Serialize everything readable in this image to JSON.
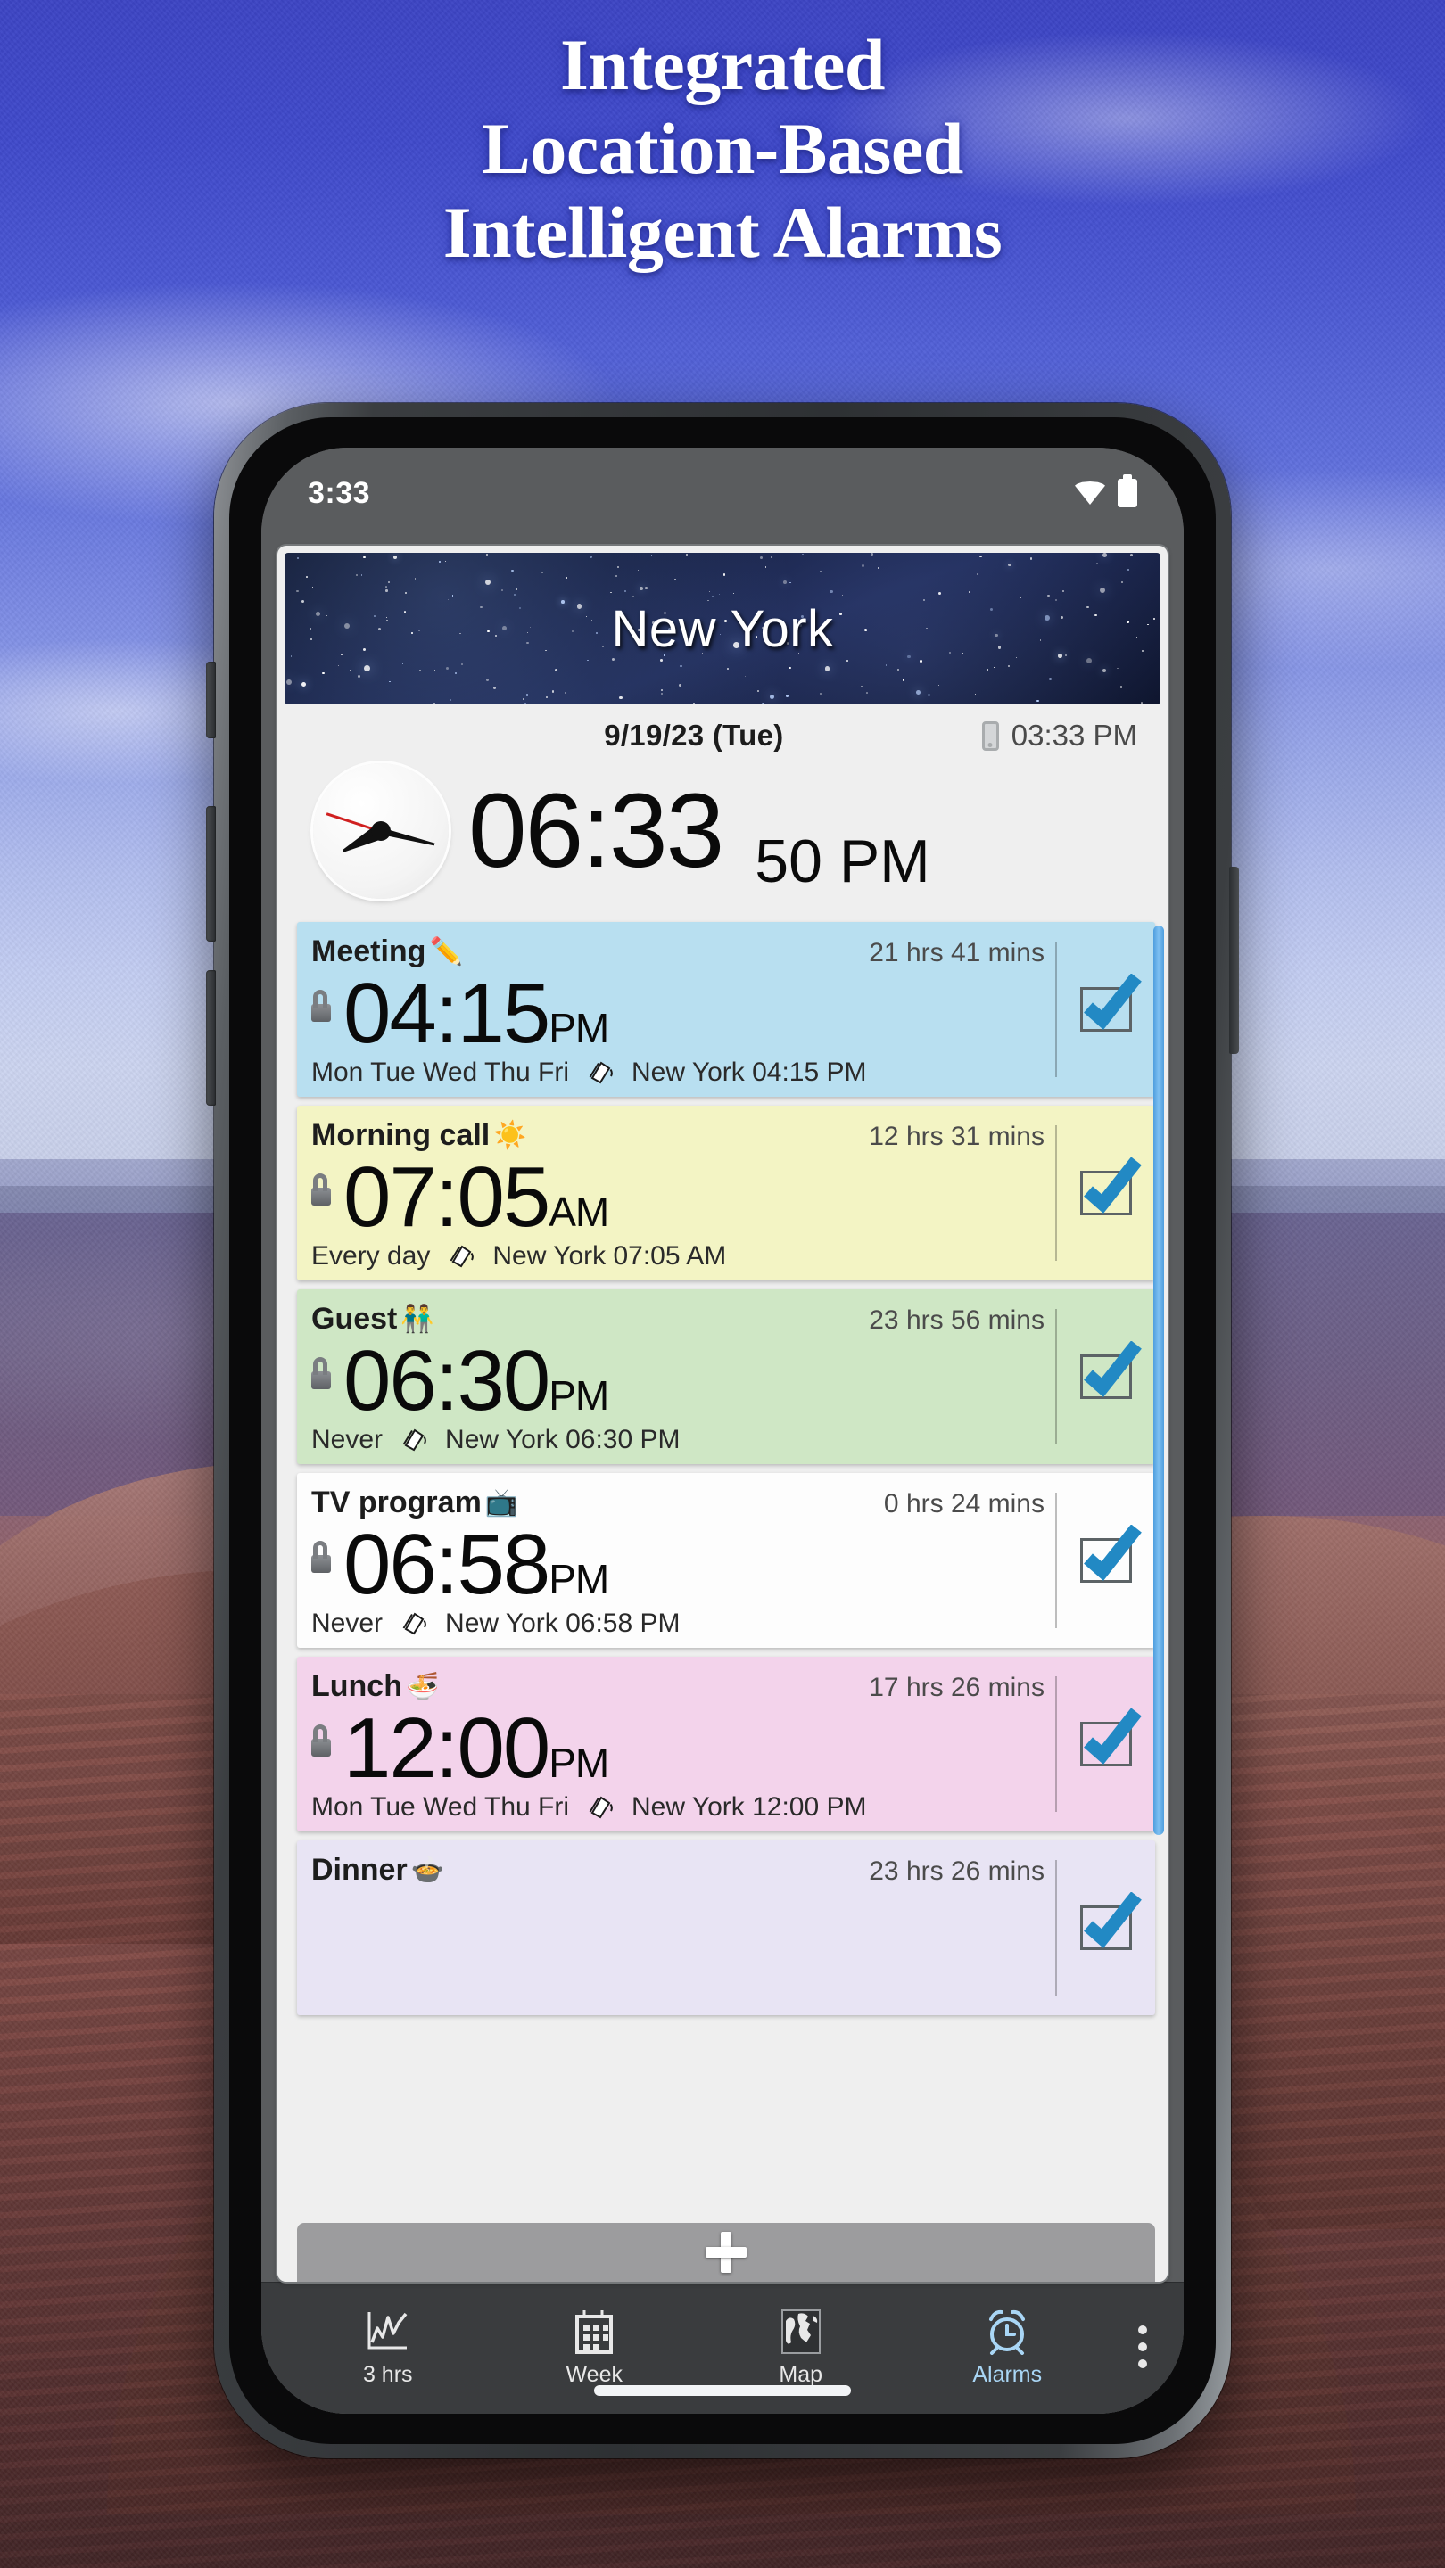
{
  "headline": {
    "lines": [
      "Integrated",
      "Location-Based",
      "Intelligent Alarms"
    ]
  },
  "phone": {
    "statusbar": {
      "time": "3:33",
      "wifi_icon": "wifi-icon",
      "battery_icon": "battery-icon"
    },
    "home_indicator": "home-indicator"
  },
  "app": {
    "city_banner": {
      "city": "New York"
    },
    "date_row": {
      "date": "9/19/23 (Tue)",
      "device_icon": "phone-icon",
      "device_time": "03:33 PM"
    },
    "clock": {
      "analog_icon": "analog-clock-icon",
      "time": "06:33",
      "seconds_ampm": "50 PM"
    },
    "alarms": [
      {
        "label": "Meeting",
        "emoji": "✏️",
        "remaining": "21 hrs 41 mins",
        "lock_icon": "unlock-icon",
        "time": "04:15",
        "ampm": "PM",
        "repeat": "Mon Tue Wed Thu Fri",
        "tz_icon": "timezone-icon",
        "location_time": "New York 04:15 PM",
        "enabled": true,
        "color": "#b8dff0"
      },
      {
        "label": "Morning call",
        "emoji": "☀️",
        "remaining": "12 hrs 31 mins",
        "lock_icon": "unlock-icon",
        "time": "07:05",
        "ampm": "AM",
        "repeat": "Every day",
        "tz_icon": "timezone-icon",
        "location_time": "New York 07:05 AM",
        "enabled": true,
        "color": "#f3f4c4"
      },
      {
        "label": "Guest",
        "emoji": "👬",
        "remaining": "23 hrs 56 mins",
        "lock_icon": "unlock-icon",
        "time": "06:30",
        "ampm": "PM",
        "repeat": "Never",
        "tz_icon": "timezone-icon",
        "location_time": "New York 06:30 PM",
        "enabled": true,
        "color": "#cfe7c5"
      },
      {
        "label": "TV program",
        "emoji": "📺",
        "remaining": "0 hrs 24 mins",
        "lock_icon": "unlock-icon",
        "time": "06:58",
        "ampm": "PM",
        "repeat": "Never",
        "tz_icon": "timezone-icon",
        "location_time": "New York 06:58 PM",
        "enabled": true,
        "color": "#fdfdfd"
      },
      {
        "label": "Lunch",
        "emoji": "🍜",
        "remaining": "17 hrs 26 mins",
        "lock_icon": "unlock-icon",
        "time": "12:00",
        "ampm": "PM",
        "repeat": "Mon Tue Wed Thu Fri",
        "tz_icon": "timezone-icon",
        "location_time": "New York 12:00 PM",
        "enabled": true,
        "color": "#f3d3eb"
      },
      {
        "label": "Dinner",
        "emoji": "🍲",
        "remaining": "23 hrs 26 mins",
        "lock_icon": "unlock-icon",
        "time": "",
        "ampm": "",
        "repeat": "",
        "tz_icon": "timezone-icon",
        "location_time": "",
        "enabled": true,
        "color": "#e8e4f4"
      }
    ],
    "add_button": {
      "icon": "plus-icon"
    },
    "nav": {
      "items": [
        {
          "label": "3 hrs",
          "icon": "chart-icon",
          "active": false
        },
        {
          "label": "Week",
          "icon": "calendar-icon",
          "active": false
        },
        {
          "label": "Map",
          "icon": "globe-icon",
          "active": false
        },
        {
          "label": "Alarms",
          "icon": "alarm-clock-icon",
          "active": true
        }
      ],
      "overflow": {
        "icon": "more-vertical-icon"
      },
      "active_color": "#a9d6f5"
    }
  }
}
